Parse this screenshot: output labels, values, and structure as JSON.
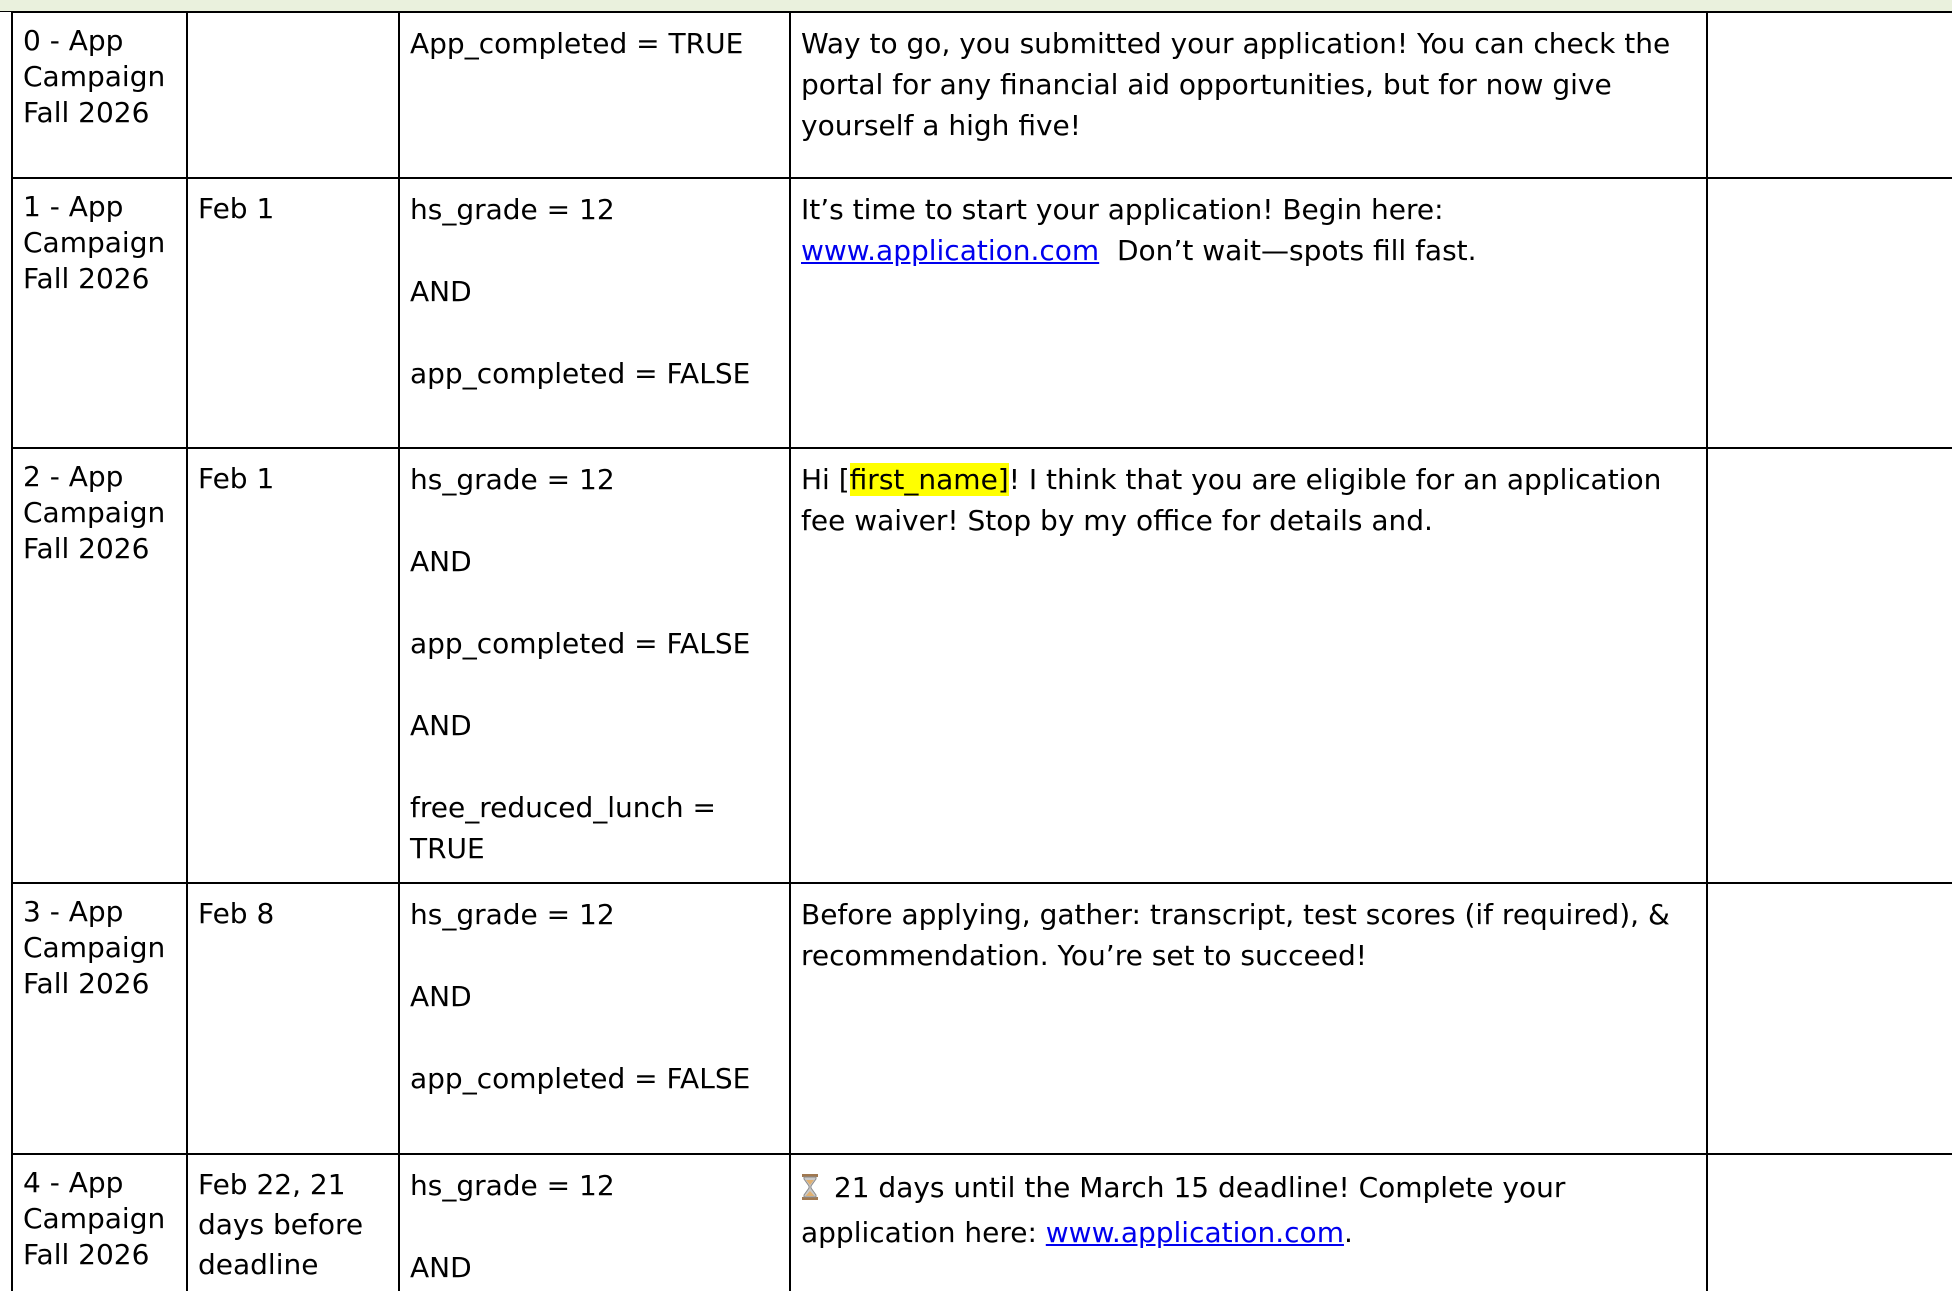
{
  "rows": [
    {
      "name": "0 - App Campaign Fall 2026",
      "date": "",
      "conditions": [
        "App_completed = TRUE"
      ],
      "message": {
        "text": "Way to go, you submitted your application! You can check the portal for any financial aid opportunities, but for now give yourself a high five!"
      },
      "notes": ""
    },
    {
      "name": "1 - App Campaign Fall 2026",
      "date": "Feb 1",
      "conditions": [
        "hs_grade = 12",
        "AND",
        "app_completed = FALSE"
      ],
      "message": {
        "before": "It’s time to start your application! Begin here: ",
        "link": "www.application.com",
        "after": "  Don’t wait—spots fill fast."
      },
      "notes": ""
    },
    {
      "name": "2 - App Campaign Fall 2026",
      "date": "Feb 1",
      "conditions": [
        "hs_grade = 12",
        "AND",
        "app_completed = FALSE",
        "AND",
        "free_reduced_lunch = TRUE"
      ],
      "message": {
        "before": "Hi [",
        "highlight": "first_name]",
        "after": "! I think that you are eligible for an application fee waiver! Stop by my office for details and."
      },
      "notes": ""
    },
    {
      "name": "3 - App Campaign Fall 2026",
      "date": "Feb 8",
      "conditions": [
        "hs_grade = 12",
        "AND",
        "app_completed = FALSE"
      ],
      "message": {
        "text": "Before applying, gather: transcript, test scores (if required), & recommendation. You’re set to succeed!"
      },
      "notes": ""
    },
    {
      "name": "4 - App Campaign Fall 2026",
      "date": "Feb 22, 21 days before deadline",
      "conditions": [
        "hs_grade = 12",
        "AND"
      ],
      "message": {
        "icon": "hourglass-icon",
        "before": " 21 days until the March 15 deadline! Complete your application here: ",
        "link": "www.application.com",
        "after": "."
      },
      "notes": ""
    }
  ],
  "colors": {
    "header_band": "#eaf1dd",
    "link": "#0000ee",
    "highlight": "#ffff00",
    "hourglass": "#a07850"
  }
}
